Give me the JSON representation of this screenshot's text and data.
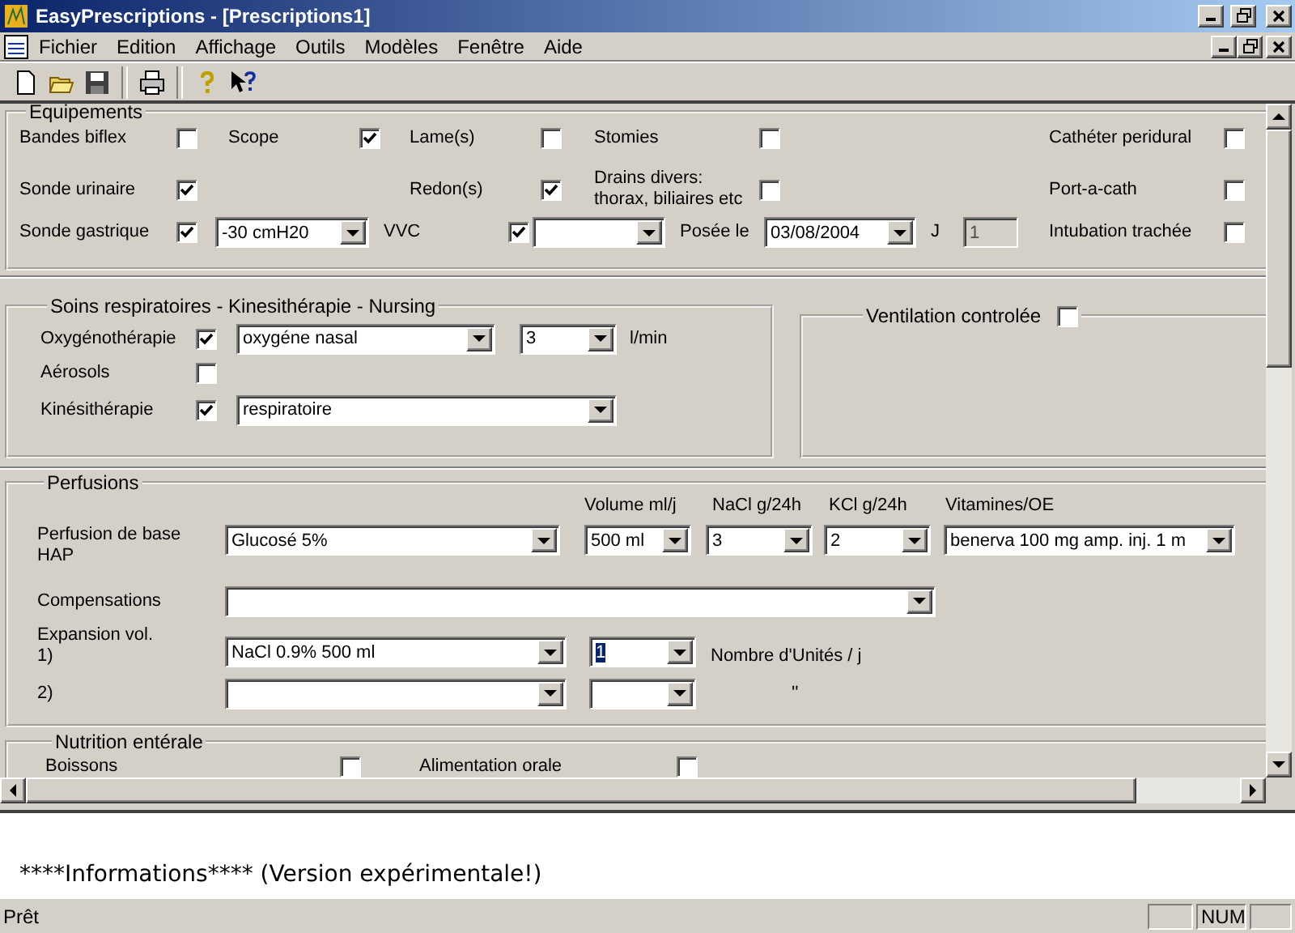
{
  "window": {
    "title": "EasyPrescriptions - [Prescriptions1]"
  },
  "menu": [
    "Fichier",
    "Edition",
    "Affichage",
    "Outils",
    "Modèles",
    "Fenêtre",
    "Aide"
  ],
  "equipements": {
    "title": "Equipements",
    "rows": [
      [
        {
          "kind": "check",
          "label": "Bandes biflex",
          "checked": false
        },
        {
          "kind": "check",
          "label": "Scope",
          "checked": true
        },
        {
          "kind": "check",
          "label": "Lame(s)",
          "checked": false
        },
        {
          "kind": "check",
          "label": "Stomies",
          "checked": false
        },
        {
          "kind": "check",
          "label": "Cathéter peridural",
          "checked": false
        }
      ],
      [
        {
          "kind": "check",
          "label": "Sonde urinaire",
          "checked": true
        },
        {
          "kind": "empty"
        },
        {
          "kind": "check",
          "label": "Redon(s)",
          "checked": true
        },
        {
          "kind": "check",
          "label": "Drains divers:\nthorax, biliaires etc",
          "checked": false
        },
        {
          "kind": "check",
          "label": "Port-a-cath",
          "checked": false
        }
      ],
      [
        {
          "kind": "check",
          "label": "Sonde gastrique",
          "checked": true
        },
        {
          "kind": "combo",
          "value": "-30 cmH20"
        },
        {
          "kind": "check",
          "label": "VVC",
          "checked": true
        },
        {
          "kind": "combo"
        },
        {
          "kind": "label",
          "text": "Posée le"
        },
        {
          "kind": "combo",
          "value": "03/08/2004"
        },
        {
          "kind": "label",
          "text": "J"
        },
        {
          "kind": "field",
          "value": "1",
          "disabled": true
        },
        {
          "kind": "check",
          "label": "Intubation trachée",
          "checked": false
        }
      ]
    ]
  },
  "soins": {
    "title": "Soins respiratoires - Kinesithérapie - Nursing",
    "rows": [
      [
        {
          "kind": "check",
          "label": "Oxygénothérapie",
          "checked": true
        },
        {
          "kind": "combo",
          "value": "oxygéne nasal"
        },
        {
          "kind": "combo",
          "value": "3"
        },
        {
          "kind": "label",
          "text": "l/min"
        }
      ],
      [
        {
          "kind": "check",
          "label": "Aérosols",
          "checked": false
        }
      ],
      [
        {
          "kind": "check",
          "label": "Kinésithérapie",
          "checked": true
        },
        {
          "kind": "combo",
          "value": "respiratoire"
        }
      ]
    ]
  },
  "ventilation": {
    "label": "Ventilation controlée",
    "checked": false
  },
  "perfusions": {
    "title": "Perfusions",
    "columns": [
      {
        "kind": "empty"
      },
      {
        "kind": "empty"
      },
      {
        "kind": "header",
        "text": "Volume ml/j"
      },
      {
        "kind": "header",
        "text": "NaCl g/24h"
      },
      {
        "kind": "header",
        "text": "KCl g/24h"
      },
      {
        "kind": "header",
        "text": "Vitamines/OE"
      }
    ],
    "rows": [
      [
        {
          "kind": "label",
          "text": "Perfusion de base\nHAP"
        },
        {
          "kind": "combo",
          "value": "Glucosé 5%"
        },
        {
          "kind": "combo",
          "value": "500 ml"
        },
        {
          "kind": "combo",
          "value": "3"
        },
        {
          "kind": "combo",
          "value": "2"
        },
        {
          "kind": "combo",
          "value": "benerva 100 mg amp.  inj. 1 m"
        }
      ],
      [
        {
          "kind": "label",
          "text": "Compensations"
        },
        {
          "kind": "combo"
        }
      ],
      [
        {
          "kind": "label",
          "text": "Expansion vol.\n1)"
        },
        {
          "kind": "combo",
          "value": "NaCl 0.9% 500 ml"
        },
        {
          "kind": "combo",
          "value": "1",
          "highlighted": true
        },
        {
          "kind": "label",
          "text": "Nombre d'Unités / j"
        }
      ],
      [
        {
          "kind": "label",
          "text": "2)"
        },
        {
          "kind": "combo"
        },
        {
          "kind": "combo"
        },
        {
          "kind": "label",
          "text": "''"
        }
      ]
    ]
  },
  "nutrition": {
    "title": "Nutrition entérale",
    "rows": [
      [
        {
          "kind": "check",
          "label": "Boissons",
          "checked": false
        },
        {
          "kind": "check",
          "label": "Alimentation orale",
          "checked": false
        }
      ]
    ]
  },
  "info": {
    "text": "****Informations**** (Version expérimentale!)"
  },
  "status_bar": {
    "message": "Prêt",
    "indicator": "NUM"
  }
}
